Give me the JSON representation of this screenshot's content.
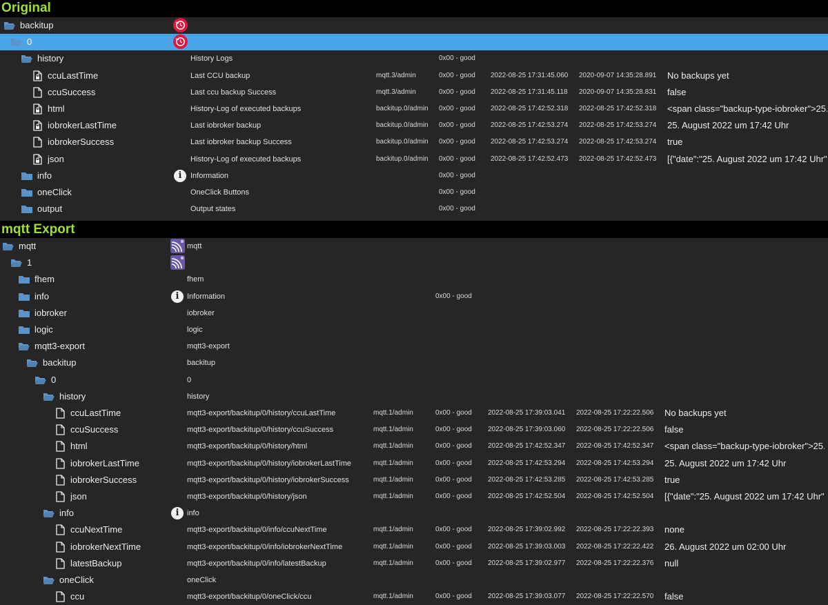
{
  "sections": {
    "original_title": "Original",
    "mqtt_title": "mqtt Export"
  },
  "original_rows": [
    {
      "name": "backitup",
      "icon": "folder-open-icon",
      "special": "history-icon",
      "desc": "",
      "user": "",
      "ack": "",
      "ts": "",
      "lc": "",
      "value": ""
    },
    {
      "name": "0",
      "icon": "folder-open-icon",
      "special": "history-icon",
      "desc": "",
      "user": "",
      "ack": "",
      "ts": "",
      "lc": "",
      "value": "",
      "selected": true
    },
    {
      "name": "history",
      "icon": "folder-open-icon",
      "desc": "History Logs",
      "user": "",
      "ack": "0x00 - good",
      "ts": "",
      "lc": "",
      "value": ""
    },
    {
      "name": "ccuLastTime",
      "icon": "file-lock-icon",
      "desc": "Last CCU backup",
      "user": "mqtt.3/admin",
      "ack": "0x00 - good",
      "ts": "2022-08-25 17:31:45.060",
      "lc": "2020-09-07 14:35:28.891",
      "value": "No backups yet"
    },
    {
      "name": "ccuSuccess",
      "icon": "file-icon",
      "desc": "Last ccu backup Success",
      "user": "mqtt.3/admin",
      "ack": "0x00 - good",
      "ts": "2022-08-25 17:31:45.118",
      "lc": "2020-09-07 14:35:28.831",
      "value": "false"
    },
    {
      "name": "html",
      "icon": "file-lock-icon",
      "desc": "History-Log of executed backups",
      "user": "backitup.0/admin",
      "ack": "0x00 - good",
      "ts": "2022-08-25 17:42:52.318",
      "lc": "2022-08-25 17:42:52.318",
      "value": "<span class=\"backup-type-iobroker\">25..."
    },
    {
      "name": "iobrokerLastTime",
      "icon": "file-lock-icon",
      "desc": "Last iobroker backup",
      "user": "backitup.0/admin",
      "ack": "0x00 - good",
      "ts": "2022-08-25 17:42:53.274",
      "lc": "2022-08-25 17:42:53.274",
      "value": "25. August 2022 um 17:42 Uhr"
    },
    {
      "name": "iobrokerSuccess",
      "icon": "file-icon",
      "desc": "Last iobroker backup Success",
      "user": "backitup.0/admin",
      "ack": "0x00 - good",
      "ts": "2022-08-25 17:42:53.274",
      "lc": "2022-08-25 17:42:53.274",
      "value": "true"
    },
    {
      "name": "json",
      "icon": "file-lock-icon",
      "desc": "History-Log of executed backups",
      "user": "backitup.0/admin",
      "ack": "0x00 - good",
      "ts": "2022-08-25 17:42:52.473",
      "lc": "2022-08-25 17:42:52.473",
      "value": "[{\"date\":\"25. August 2022 um 17:42 Uhr\",..."
    },
    {
      "name": "info",
      "icon": "folder-icon",
      "special": "info-icon",
      "desc": "Information",
      "user": "",
      "ack": "0x00 - good",
      "ts": "",
      "lc": "",
      "value": ""
    },
    {
      "name": "oneClick",
      "icon": "folder-icon",
      "desc": "OneClick Buttons",
      "user": "",
      "ack": "0x00 - good",
      "ts": "",
      "lc": "",
      "value": ""
    },
    {
      "name": "output",
      "icon": "folder-icon",
      "desc": "Output states",
      "user": "",
      "ack": "0x00 - good",
      "ts": "",
      "lc": "",
      "value": ""
    }
  ],
  "mqtt_rows": [
    {
      "name": "mqtt",
      "icon": "folder-open-icon",
      "special": "mqtt-icon",
      "desc": "mqtt",
      "user": "",
      "ack": "",
      "ts": "",
      "lc": "",
      "value": ""
    },
    {
      "name": "1",
      "icon": "folder-open-icon",
      "special": "mqtt-icon",
      "desc": "",
      "user": "",
      "ack": "",
      "ts": "",
      "lc": "",
      "value": ""
    },
    {
      "name": "fhem",
      "icon": "folder-icon",
      "desc": "fhem",
      "user": "",
      "ack": "",
      "ts": "",
      "lc": "",
      "value": ""
    },
    {
      "name": "info",
      "icon": "folder-icon",
      "special": "info-icon",
      "desc": "Information",
      "user": "",
      "ack": "0x00 - good",
      "ts": "",
      "lc": "",
      "value": ""
    },
    {
      "name": "iobroker",
      "icon": "folder-icon",
      "desc": "iobroker",
      "user": "",
      "ack": "",
      "ts": "",
      "lc": "",
      "value": ""
    },
    {
      "name": "logic",
      "icon": "folder-icon",
      "desc": "logic",
      "user": "",
      "ack": "",
      "ts": "",
      "lc": "",
      "value": ""
    },
    {
      "name": "mqtt3-export",
      "icon": "folder-open-icon",
      "desc": "mqtt3-export",
      "user": "",
      "ack": "",
      "ts": "",
      "lc": "",
      "value": ""
    },
    {
      "name": "backitup",
      "icon": "folder-open-icon",
      "desc": "backitup",
      "user": "",
      "ack": "",
      "ts": "",
      "lc": "",
      "value": ""
    },
    {
      "name": "0",
      "icon": "folder-open-icon",
      "desc": "0",
      "user": "",
      "ack": "",
      "ts": "",
      "lc": "",
      "value": ""
    },
    {
      "name": "history",
      "icon": "folder-open-icon",
      "desc": "history",
      "user": "",
      "ack": "",
      "ts": "",
      "lc": "",
      "value": ""
    },
    {
      "name": "ccuLastTime",
      "icon": "file-icon",
      "desc": "mqtt3-export/backitup/0/history/ccuLastTime",
      "user": "mqtt.1/admin",
      "ack": "0x00 - good",
      "ts": "2022-08-25 17:39:03.041",
      "lc": "2022-08-25 17:22:22.506",
      "value": "No backups yet"
    },
    {
      "name": "ccuSuccess",
      "icon": "file-icon",
      "desc": "mqtt3-export/backitup/0/history/ccuSuccess",
      "user": "mqtt.1/admin",
      "ack": "0x00 - good",
      "ts": "2022-08-25 17:39:03.060",
      "lc": "2022-08-25 17:22:22.506",
      "value": "false"
    },
    {
      "name": "html",
      "icon": "file-icon",
      "desc": "mqtt3-export/backitup/0/history/html",
      "user": "mqtt.1/admin",
      "ack": "0x00 - good",
      "ts": "2022-08-25 17:42:52.347",
      "lc": "2022-08-25 17:42:52.347",
      "value": "<span class=\"backup-type-iobroker\">25..."
    },
    {
      "name": "iobrokerLastTime",
      "icon": "file-icon",
      "desc": "mqtt3-export/backitup/0/history/iobrokerLastTime",
      "user": "mqtt.1/admin",
      "ack": "0x00 - good",
      "ts": "2022-08-25 17:42:53.294",
      "lc": "2022-08-25 17:42:53.294",
      "value": "25. August 2022 um 17:42 Uhr"
    },
    {
      "name": "iobrokerSuccess",
      "icon": "file-icon",
      "desc": "mqtt3-export/backitup/0/history/iobrokerSuccess",
      "user": "mqtt.1/admin",
      "ack": "0x00 - good",
      "ts": "2022-08-25 17:42:53.285",
      "lc": "2022-08-25 17:42:53.285",
      "value": "true"
    },
    {
      "name": "json",
      "icon": "file-icon",
      "desc": "mqtt3-export/backitup/0/history/json",
      "user": "mqtt.1/admin",
      "ack": "0x00 - good",
      "ts": "2022-08-25 17:42:52.504",
      "lc": "2022-08-25 17:42:52.504",
      "value": "[{\"date\":\"25. August 2022 um 17:42 Uhr\",..."
    },
    {
      "name": "info",
      "icon": "folder-open-icon",
      "special": "info-icon",
      "desc": "info",
      "user": "",
      "ack": "",
      "ts": "",
      "lc": "",
      "value": ""
    },
    {
      "name": "ccuNextTime",
      "icon": "file-icon",
      "desc": "mqtt3-export/backitup/0/info/ccuNextTime",
      "user": "mqtt.1/admin",
      "ack": "0x00 - good",
      "ts": "2022-08-25 17:39:02.992",
      "lc": "2022-08-25 17:22:22.393",
      "value": "none"
    },
    {
      "name": "iobrokerNextTime",
      "icon": "file-icon",
      "desc": "mqtt3-export/backitup/0/info/iobrokerNextTime",
      "user": "mqtt.1/admin",
      "ack": "0x00 - good",
      "ts": "2022-08-25 17:39:03.003",
      "lc": "2022-08-25 17:22:22.422",
      "value": "26. August 2022 um 02:00 Uhr"
    },
    {
      "name": "latestBackup",
      "icon": "file-icon",
      "desc": "mqtt3-export/backitup/0/info/latestBackup",
      "user": "mqtt.1/admin",
      "ack": "0x00 - good",
      "ts": "2022-08-25 17:39:02.977",
      "lc": "2022-08-25 17:22:22.376",
      "value": "null"
    },
    {
      "name": "oneClick",
      "icon": "folder-open-icon",
      "desc": "oneClick",
      "user": "",
      "ack": "",
      "ts": "",
      "lc": "",
      "value": ""
    },
    {
      "name": "ccu",
      "icon": "file-icon",
      "desc": "mqtt3-export/backitup/0/oneClick/ccu",
      "user": "mqtt.1/admin",
      "ack": "0x00 - good",
      "ts": "2022-08-25 17:39:03.077",
      "lc": "2022-08-25 17:22:22.570",
      "value": "false"
    }
  ],
  "colors": {
    "background": "#262626",
    "selected": "#4aa6e8",
    "folder": "#5b93c8",
    "title": "#9fe030",
    "history_icon": "#e0163f"
  }
}
